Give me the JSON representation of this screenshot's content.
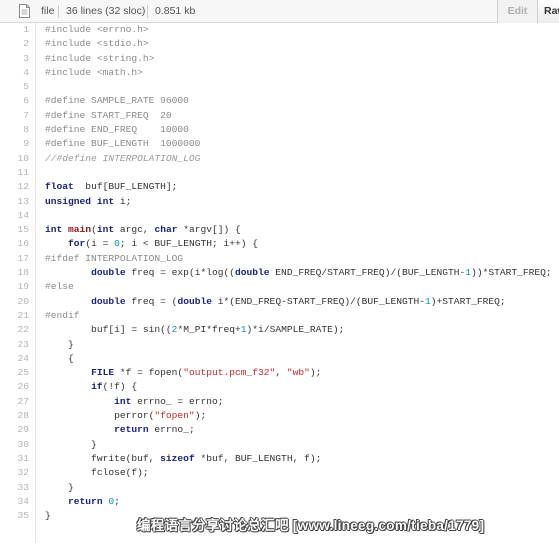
{
  "header": {
    "file_label": "file",
    "lines_info": "36 lines (32 sloc)",
    "size_info": "0.851 kb",
    "edit_label": "Edit",
    "raw_label": "Raw"
  },
  "code_lines": [
    [
      [
        "pp",
        "#include <errno.h>"
      ]
    ],
    [
      [
        "pp",
        "#include <stdio.h>"
      ]
    ],
    [
      [
        "pp",
        "#include <string.h>"
      ]
    ],
    [
      [
        "pp",
        "#include <math.h>"
      ]
    ],
    [],
    [
      [
        "pp",
        "#define SAMPLE_RATE 96000"
      ]
    ],
    [
      [
        "pp",
        "#define START_FREQ  20"
      ]
    ],
    [
      [
        "pp",
        "#define END_FREQ    10000"
      ]
    ],
    [
      [
        "pp",
        "#define BUF_LENGTH  1000000"
      ]
    ],
    [
      [
        "cm",
        "//#define INTERPOLATION_LOG"
      ]
    ],
    [],
    [
      [
        "kw",
        "float"
      ],
      [
        "",
        "  buf[BUF_LENGTH];"
      ]
    ],
    [
      [
        "kw",
        "unsigned"
      ],
      [
        "",
        " "
      ],
      [
        "kw",
        "int"
      ],
      [
        "",
        " i;"
      ]
    ],
    [],
    [
      [
        "kw",
        "int"
      ],
      [
        "",
        " "
      ],
      [
        "fn",
        "main"
      ],
      [
        "",
        "("
      ],
      [
        "kw",
        "int"
      ],
      [
        "",
        " argc, "
      ],
      [
        "kw",
        "char"
      ],
      [
        "",
        " *argv[]) {"
      ]
    ],
    [
      [
        "",
        "    "
      ],
      [
        "kw",
        "for"
      ],
      [
        "",
        "(i = "
      ],
      [
        "num",
        "0"
      ],
      [
        "",
        "; i < BUF_LENGTH; i++) {"
      ]
    ],
    [
      [
        "pp",
        "#ifdef INTERPOLATION_LOG"
      ]
    ],
    [
      [
        "",
        "        "
      ],
      [
        "kw",
        "double"
      ],
      [
        "",
        " freq = exp(i*log(("
      ],
      [
        "kw",
        "double"
      ],
      [
        "",
        " END_FREQ/START_FREQ)/(BUF_LENGTH-"
      ],
      [
        "num",
        "1"
      ],
      [
        "",
        "))*START_FREQ;"
      ]
    ],
    [
      [
        "pp",
        "#else"
      ]
    ],
    [
      [
        "",
        "        "
      ],
      [
        "kw",
        "double"
      ],
      [
        "",
        " freq = ("
      ],
      [
        "kw",
        "double"
      ],
      [
        "",
        " i*(END_FREQ-START_FREQ)/(BUF_LENGTH-"
      ],
      [
        "num",
        "1"
      ],
      [
        "",
        ")+START_FREQ;"
      ]
    ],
    [
      [
        "pp",
        "#endif"
      ]
    ],
    [
      [
        "",
        "        buf[i] = sin(("
      ],
      [
        "num",
        "2"
      ],
      [
        "",
        "*M_PI*freq+"
      ],
      [
        "num",
        "1"
      ],
      [
        "",
        ")*i/SAMPLE_RATE);"
      ]
    ],
    [
      [
        "",
        "    }"
      ]
    ],
    [
      [
        "",
        "    {"
      ]
    ],
    [
      [
        "",
        "        "
      ],
      [
        "kw",
        "FILE"
      ],
      [
        "",
        " *f = fopen("
      ],
      [
        "str",
        "\"output.pcm_f32\""
      ],
      [
        "",
        ", "
      ],
      [
        "str",
        "\"wb\""
      ],
      [
        "",
        ");"
      ]
    ],
    [
      [
        "",
        "        "
      ],
      [
        "kw",
        "if"
      ],
      [
        "",
        "(!f) {"
      ]
    ],
    [
      [
        "",
        "            "
      ],
      [
        "kw",
        "int"
      ],
      [
        "",
        " errno_ = errno;"
      ]
    ],
    [
      [
        "",
        "            perror("
      ],
      [
        "str",
        "\"fopen\""
      ],
      [
        "",
        ");"
      ]
    ],
    [
      [
        "",
        "            "
      ],
      [
        "kw",
        "return"
      ],
      [
        "",
        " errno_;"
      ]
    ],
    [
      [
        "",
        "        }"
      ]
    ],
    [
      [
        "",
        "        fwrite(buf, "
      ],
      [
        "kw",
        "sizeof"
      ],
      [
        "",
        " *buf, BUF_LENGTH, f);"
      ]
    ],
    [
      [
        "",
        "        fclose(f);"
      ]
    ],
    [
      [
        "",
        "    }"
      ]
    ],
    [
      [
        "",
        "    "
      ],
      [
        "kw",
        "return"
      ],
      [
        "",
        " "
      ],
      [
        "num",
        "0"
      ],
      [
        "",
        ";"
      ]
    ],
    [
      [
        "",
        "}"
      ]
    ]
  ],
  "watermark": "编程语言分享讨论总汇吧 [www.lineeg.com/tieba/1779]",
  "colors": {
    "keyword": "#1a237e",
    "preprocessor": "#8a8a8a",
    "string": "#c62828",
    "number": "#009999",
    "line_number": "#b4b4b4"
  }
}
